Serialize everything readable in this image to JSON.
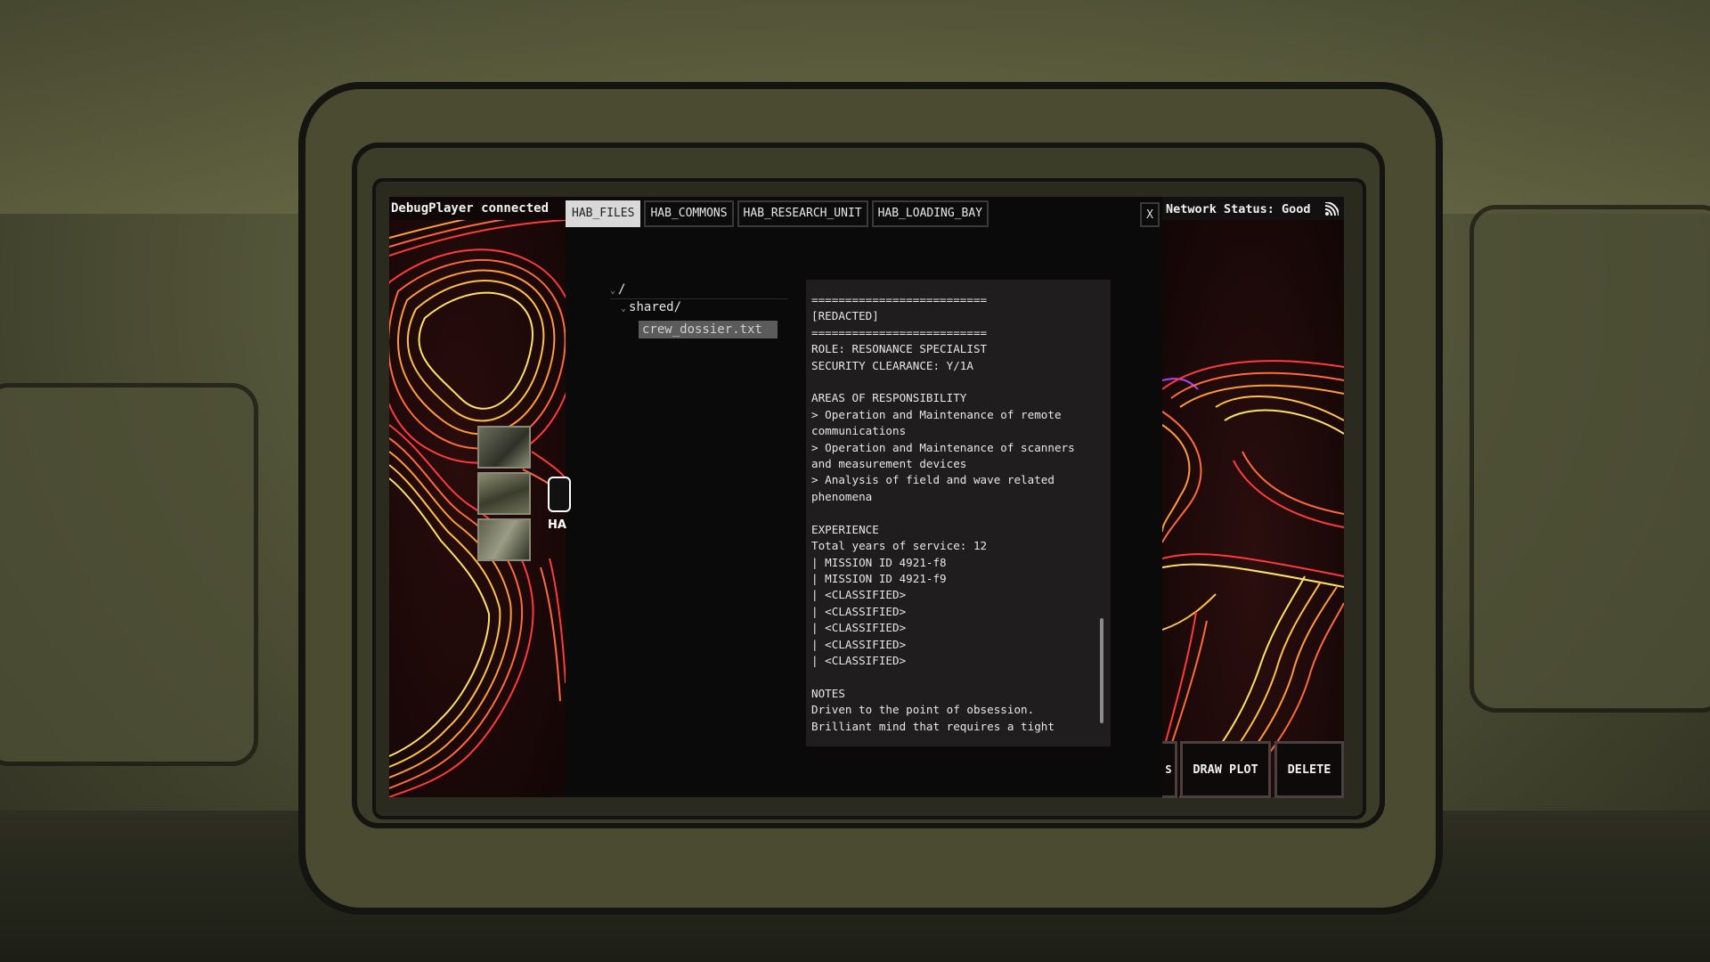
{
  "screen": {
    "connection_status": "DebugPlayer connected",
    "network_status": "Network Status: Good",
    "network_icon": "rss-signal-icon"
  },
  "tabs": [
    {
      "label": "HAB_FILES",
      "active": true
    },
    {
      "label": "HAB_COMMONS",
      "active": false
    },
    {
      "label": "HAB_RESEARCH_UNIT",
      "active": false
    },
    {
      "label": "HAB_LOADING_BAY",
      "active": false
    }
  ],
  "close_label": "X",
  "file_tree": {
    "root": "/",
    "folder": "shared/",
    "file": "crew_dossier.txt"
  },
  "document": {
    "text": "==========================\n[REDACTED]\n==========================\nROLE: RESONANCE SPECIALIST\nSECURITY CLEARANCE: Y/1A\n\nAREAS OF RESPONSIBILITY\n> Operation and Maintenance of remote communications\n> Operation and Maintenance of scanners and measurement devices\n> Analysis of field and wave related phenomena\n\nEXPERIENCE\nTotal years of service: 12\n| MISSION ID 4921-f8\n| MISSION ID 4921-f9\n| <CLASSIFIED>\n| <CLASSIFIED>\n| <CLASSIFIED>\n| <CLASSIFIED>\n| <CLASSIFIED>\n\nNOTES\nDriven to the point of obsession.\nBrilliant mind that requires a tight"
  },
  "map": {
    "hab_label": "HA",
    "right_partial_button": "S"
  },
  "buttons": {
    "draw_plot": "DRAW PLOT",
    "delete": "DELETE"
  },
  "colors": {
    "contour_hot": "#ffe066",
    "contour_mid": "#ff8a3a",
    "contour_cool": "#ff3040",
    "tab_active_bg": "#d9d9d9"
  }
}
